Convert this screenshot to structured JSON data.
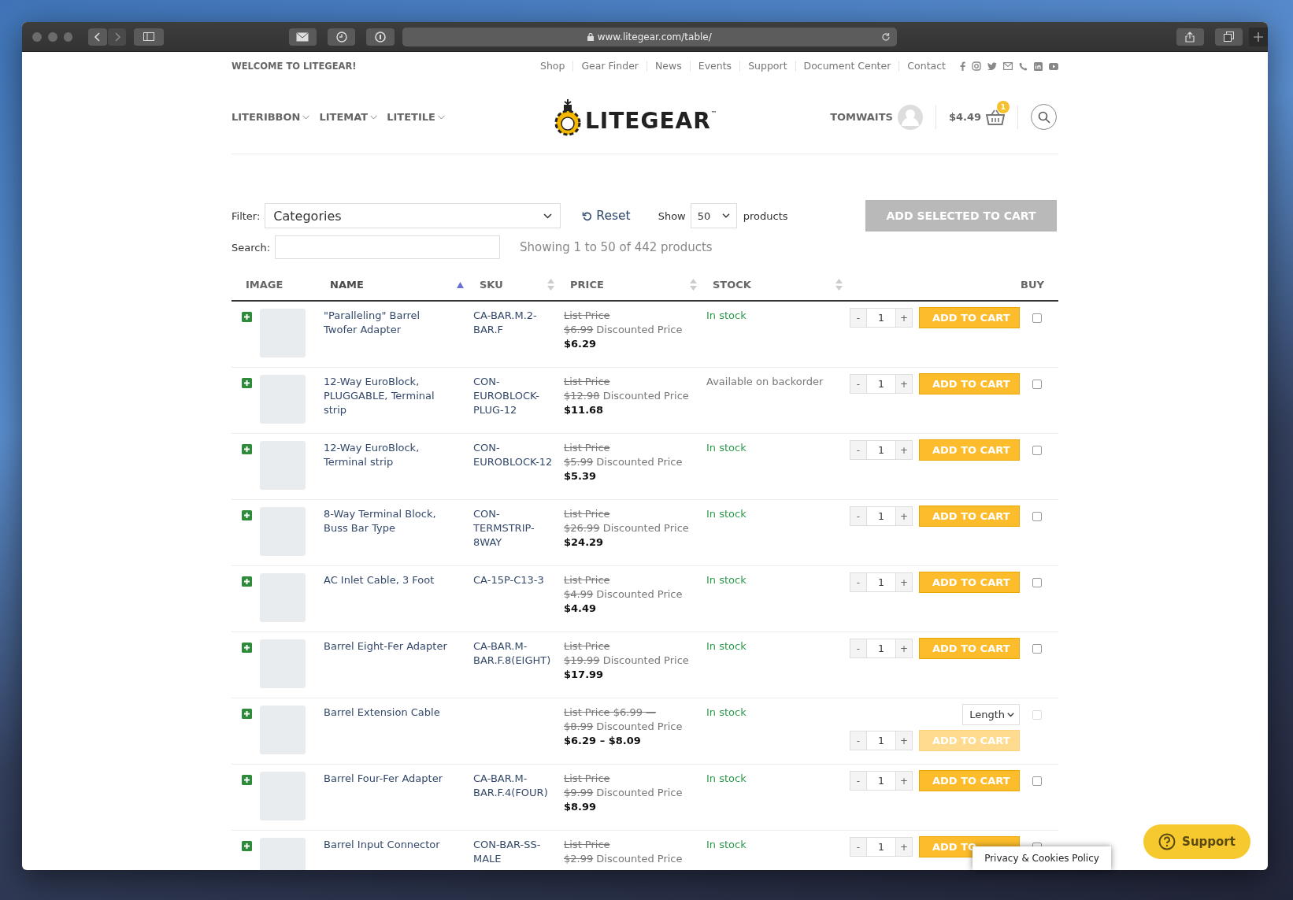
{
  "browser": {
    "url": "www.litegear.com/table/"
  },
  "topbar": {
    "welcome": "WELCOME TO LITEGEAR!",
    "links": [
      "Shop",
      "Gear Finder",
      "News",
      "Events",
      "Support",
      "Document Center",
      "Contact"
    ]
  },
  "nav": {
    "menus": [
      "LITERIBBON",
      "LITEMAT",
      "LITETILE"
    ],
    "logo": "LITEGEAR",
    "logo_mark": "™",
    "user": "TOMWAITS",
    "cart_total": "$4.49",
    "cart_count": "1"
  },
  "controls": {
    "filter_label": "Filter:",
    "filter_value": "Categories",
    "reset": "Reset",
    "show_label": "Show",
    "show_value": "50",
    "show_suffix": "products",
    "add_selected": "ADD SELECTED TO CART",
    "search_label": "Search:",
    "summary": "Showing 1 to 50 of 442 products"
  },
  "table": {
    "columns": [
      {
        "label": "IMAGE",
        "sortable": false,
        "selected": false
      },
      {
        "label": "NAME",
        "sortable": true,
        "selected": true
      },
      {
        "label": "SKU",
        "sortable": true,
        "selected": false
      },
      {
        "label": "PRICE",
        "sortable": true,
        "selected": false
      },
      {
        "label": "STOCK",
        "sortable": true,
        "selected": false
      },
      {
        "label": "BUY",
        "sortable": false,
        "selected": false
      }
    ],
    "rows": [
      {
        "name": "\"Paralleling\" Barrel Twofer Adapter",
        "sku": "CA-BAR.M.2-BAR.F",
        "price": {
          "list": "List Price",
          "old": "$6.99",
          "label": "Discounted Price",
          "now": "$6.29"
        },
        "stock": "In stock",
        "in_stock": true,
        "kind": "simple",
        "dec": "-",
        "qty": "1",
        "inc": "+",
        "button": "ADD TO CART",
        "disabled": false,
        "checked": false
      },
      {
        "name": "12-Way EuroBlock, PLUGGABLE, Terminal strip",
        "sku": "CON-EUROBLOCK-PLUG-12",
        "price": {
          "list": "List Price",
          "old": "$12.98",
          "label": "Discounted Price",
          "now": "$11.68"
        },
        "stock": "Available on backorder",
        "in_stock": false,
        "kind": "simple",
        "dec": "-",
        "qty": "1",
        "inc": "+",
        "button": "ADD TO CART",
        "disabled": false,
        "checked": false
      },
      {
        "name": "12-Way EuroBlock, Terminal strip",
        "sku": "CON-EUROBLOCK-12",
        "price": {
          "list": "List Price",
          "old": "$5.99",
          "label": "Discounted Price",
          "now": "$5.39"
        },
        "stock": "In stock",
        "in_stock": true,
        "kind": "simple",
        "dec": "-",
        "qty": "1",
        "inc": "+",
        "button": "ADD TO CART",
        "disabled": false,
        "checked": false
      },
      {
        "name": "8-Way Terminal Block, Buss Bar Type",
        "sku": "CON-TERMSTRIP-8WAY",
        "price": {
          "list": "List Price",
          "old": "$26.99",
          "label": "Discounted Price",
          "now": "$24.29"
        },
        "stock": "In stock",
        "in_stock": true,
        "kind": "simple",
        "dec": "-",
        "qty": "1",
        "inc": "+",
        "button": "ADD TO CART",
        "disabled": false,
        "checked": false
      },
      {
        "name": "AC Inlet Cable, 3 Foot",
        "sku": "CA-15P-C13-3",
        "price": {
          "list": "List Price",
          "old": "$4.99",
          "label": "Discounted Price",
          "now": "$4.49"
        },
        "stock": "In stock",
        "in_stock": true,
        "kind": "simple",
        "dec": "-",
        "qty": "1",
        "inc": "+",
        "button": "ADD TO CART",
        "disabled": false,
        "checked": false
      },
      {
        "name": "Barrel Eight-Fer Adapter",
        "sku": "CA-BAR.M-BAR.F.8(EIGHT)",
        "price": {
          "list": "List Price",
          "old": "$19.99",
          "label": "Discounted Price",
          "now": "$17.99"
        },
        "stock": "In stock",
        "in_stock": true,
        "kind": "simple",
        "dec": "-",
        "qty": "1",
        "inc": "+",
        "button": "ADD TO CART",
        "disabled": false,
        "checked": false
      },
      {
        "name": "Barrel Extension Cable",
        "price": {
          "list": "List Price $6.99 —",
          "old": "$8.99",
          "label": "Discounted Price",
          "now": "$6.29 – $8.09"
        },
        "stock": "In stock",
        "in_stock": true,
        "kind": "variable",
        "option": "Length",
        "dec": "-",
        "qty": "1",
        "inc": "+",
        "button": "ADD TO CART",
        "disabled": true,
        "checked": false
      },
      {
        "name": "Barrel Four-Fer Adapter",
        "sku": "CA-BAR.M-BAR.F.4(FOUR)",
        "price": {
          "list": "List Price",
          "old": "$9.99",
          "label": "Discounted Price",
          "now": "$8.99"
        },
        "stock": "In stock",
        "in_stock": true,
        "kind": "simple",
        "dec": "-",
        "qty": "1",
        "inc": "+",
        "button": "ADD TO CART",
        "disabled": false,
        "checked": false
      },
      {
        "name": "Barrel Input Connector",
        "sku": "CON-BAR-SS-MALE",
        "price": {
          "list": "List Price",
          "old": "$2.99",
          "label": "Discounted Price"
        },
        "stock": "In stock",
        "in_stock": true,
        "kind": "simple",
        "dec": "-",
        "qty": "1",
        "inc": "+",
        "button": "ADD TO",
        "disabled": false,
        "checked": false
      }
    ]
  },
  "privacy": "Privacy & Cookies Policy",
  "support": "Support"
}
